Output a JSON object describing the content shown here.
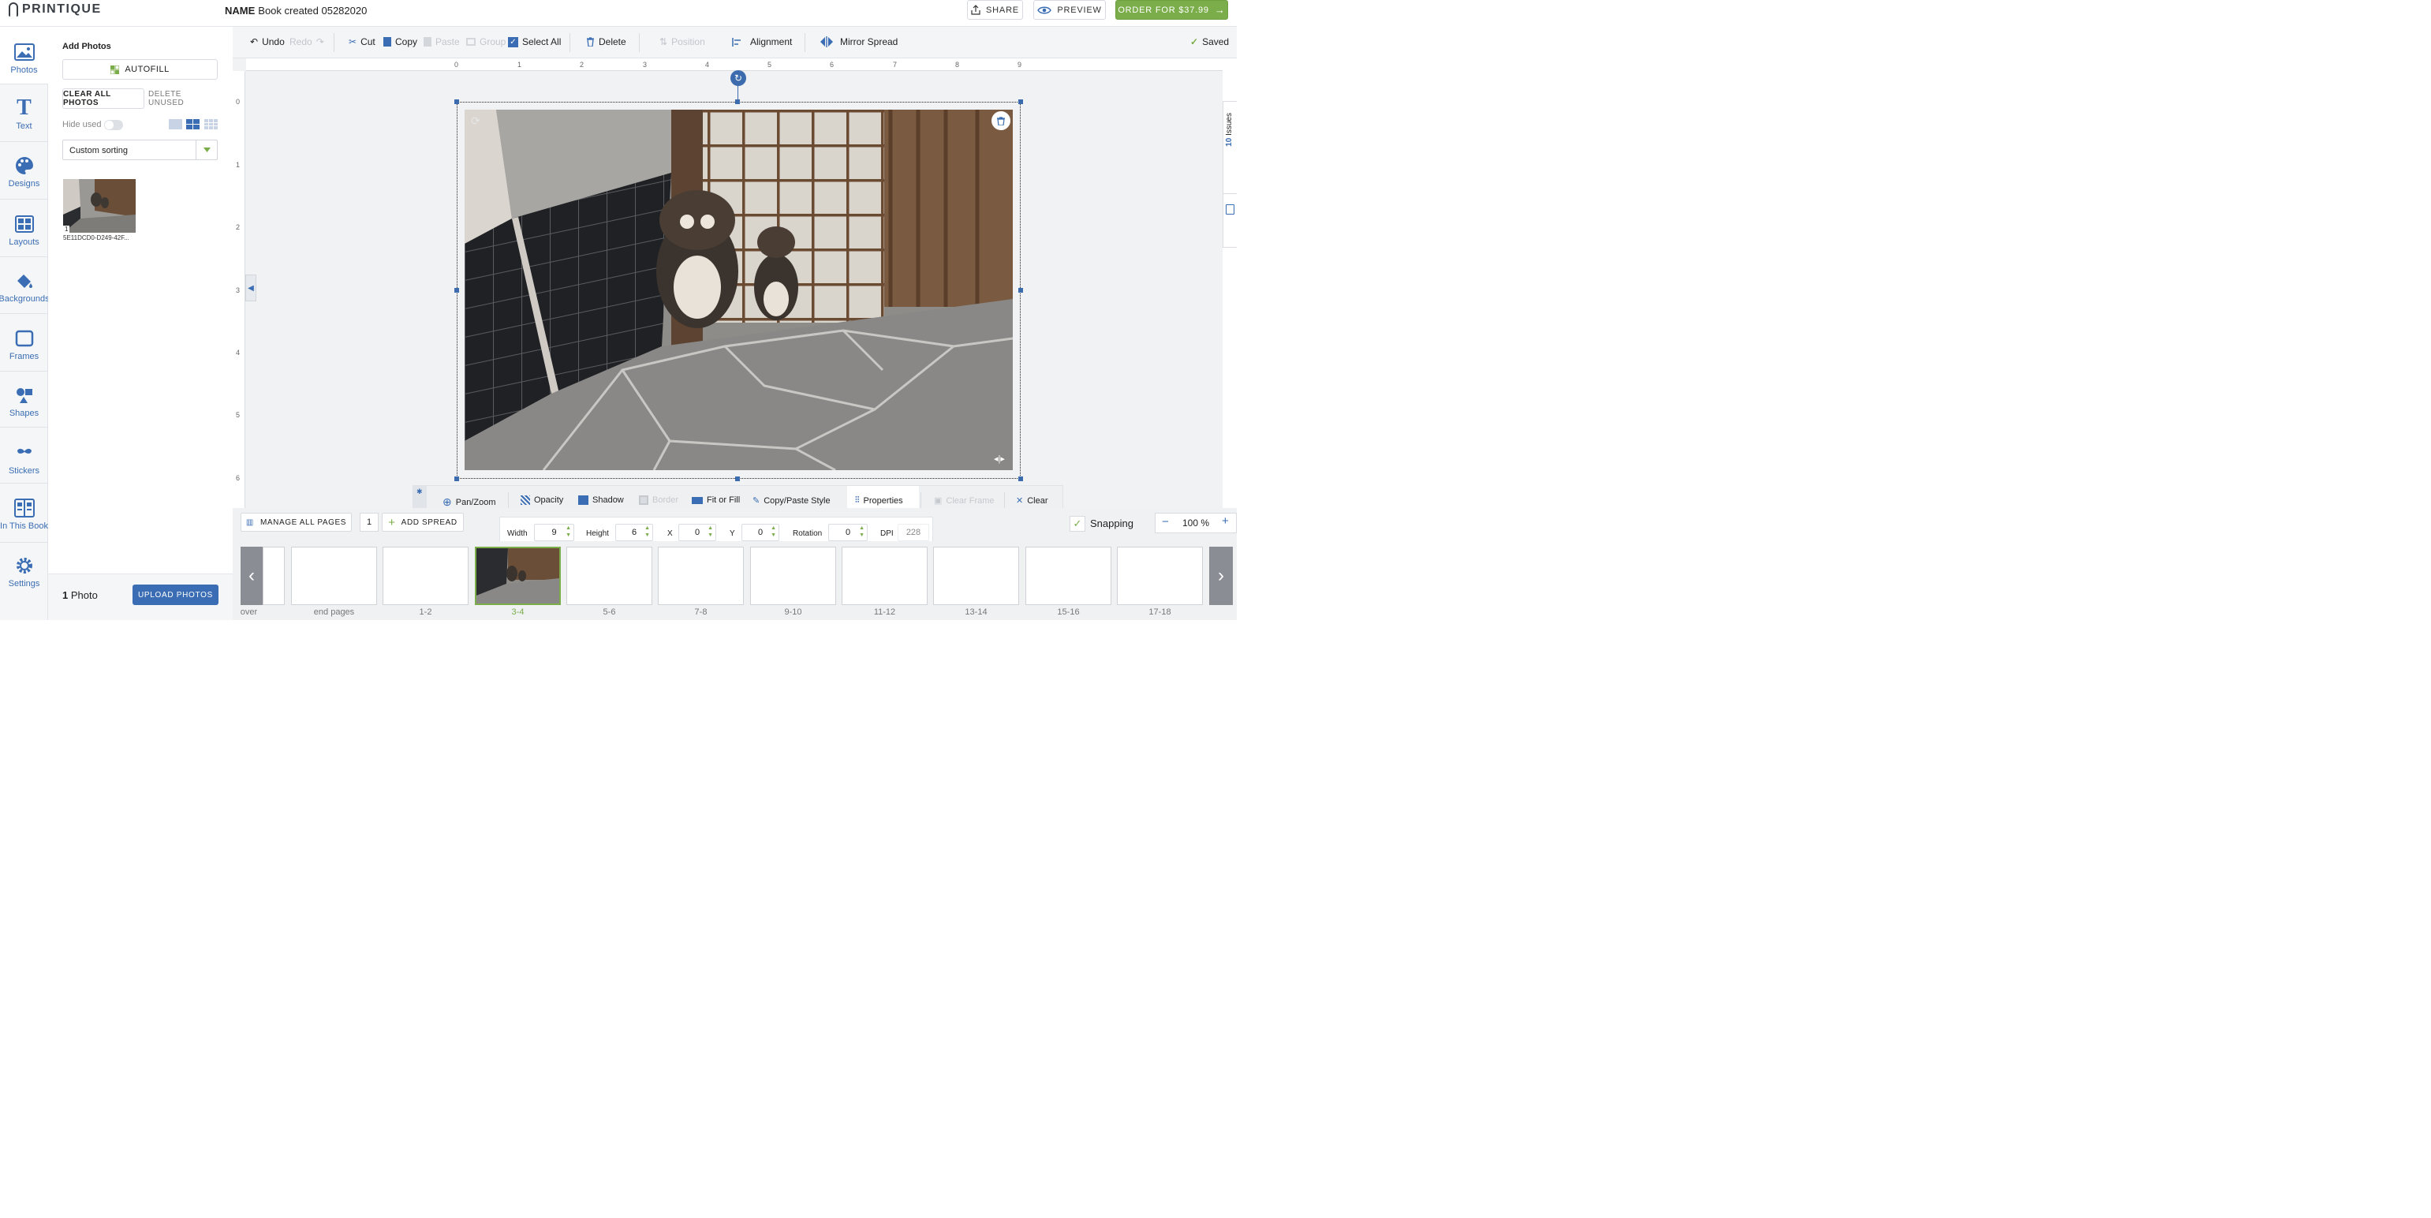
{
  "app": {
    "logo": "PRINTIQUE"
  },
  "header": {
    "name_label": "NAME",
    "book_name": "Book created 05282020",
    "share": "SHARE",
    "preview": "PREVIEW",
    "order": "ORDER FOR $37.99"
  },
  "rail": [
    {
      "label": "Photos",
      "icon": "photo-icon"
    },
    {
      "label": "Text",
      "icon": "text-icon"
    },
    {
      "label": "Designs",
      "icon": "palette-icon"
    },
    {
      "label": "Layouts",
      "icon": "layouts-icon"
    },
    {
      "label": "Backgrounds",
      "icon": "paint-bucket-icon"
    },
    {
      "label": "Frames",
      "icon": "frame-icon"
    },
    {
      "label": "Shapes",
      "icon": "shapes-icon"
    },
    {
      "label": "Stickers",
      "icon": "mustache-icon"
    },
    {
      "label": "In This Book",
      "icon": "book-icon"
    },
    {
      "label": "Settings",
      "icon": "gear-icon"
    }
  ],
  "panel": {
    "title": "Add Photos",
    "autofill": "AUTOFILL",
    "clear_all": "CLEAR ALL PHOTOS",
    "delete_unused": "DELETE UNUSED",
    "hide_used": "Hide used",
    "sorting": "Custom sorting",
    "photo": {
      "badge": "1",
      "filename": "5E11DCD0-D249-42F..."
    },
    "count": "1",
    "count_label": "Photo",
    "upload": "UPLOAD PHOTOS"
  },
  "toolbar": {
    "undo": "Undo",
    "redo": "Redo",
    "cut": "Cut",
    "copy": "Copy",
    "paste": "Paste",
    "group": "Group",
    "select_all": "Select All",
    "delete": "Delete",
    "position": "Position",
    "alignment": "Alignment",
    "mirror": "Mirror Spread",
    "saved": "Saved"
  },
  "ruler": {
    "h": [
      "0",
      "1",
      "2",
      "3",
      "4",
      "5",
      "6",
      "7",
      "8",
      "9"
    ],
    "v": [
      "0",
      "1",
      "2",
      "3",
      "4",
      "5",
      "6"
    ]
  },
  "side_tab": {
    "count": "10",
    "label": "Issues"
  },
  "context": {
    "pan_zoom": "Pan/Zoom",
    "opacity": "Opacity",
    "shadow": "Shadow",
    "border": "Border",
    "fit_fill": "Fit or Fill",
    "copy_paste_style": "Copy/Paste Style",
    "properties": "Properties",
    "clear_frame": "Clear Frame",
    "clear": "Clear"
  },
  "properties": {
    "width_label": "Width",
    "width": "9",
    "height_label": "Height",
    "height": "6",
    "x_label": "X",
    "x": "0",
    "y_label": "Y",
    "y": "0",
    "rotation_label": "Rotation",
    "rotation": "0",
    "dpi_label": "DPI",
    "dpi": "228"
  },
  "pagebar": {
    "manage": "MANAGE ALL PAGES",
    "page": "1",
    "add_spread": "ADD SPREAD",
    "snapping": "Snapping",
    "zoom": "100 %"
  },
  "pages": [
    "over",
    "end pages",
    "1-2",
    "3-4",
    "5-6",
    "7-8",
    "9-10",
    "11-12",
    "13-14",
    "15-16",
    "17-18"
  ],
  "active_page": "3-4",
  "colors": {
    "accent": "#3a6db3",
    "order": "#7bae4a",
    "active_page": "#7bae4a"
  }
}
